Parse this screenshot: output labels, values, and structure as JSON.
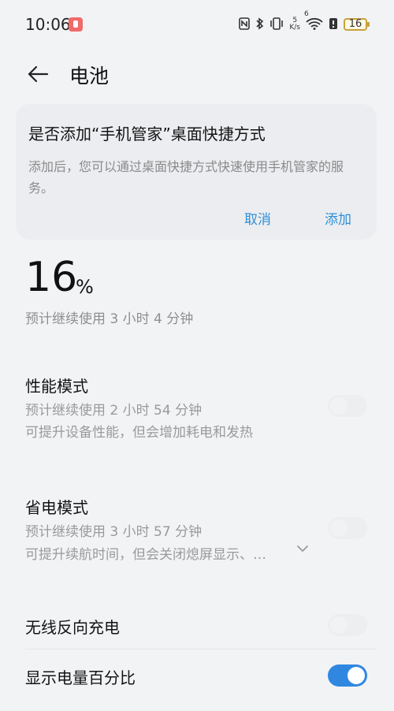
{
  "status_bar": {
    "time": "10:06",
    "net_speed_value": "5",
    "net_speed_unit": "K/s",
    "wifi_label": "6",
    "battery_level": "16"
  },
  "header": {
    "title": "电池"
  },
  "shortcut_card": {
    "title": "是否添加“手机管家”桌面快捷方式",
    "description": "添加后，您可以通过桌面快捷方式快速使用手机管家的服务。",
    "cancel_label": "取消",
    "add_label": "添加"
  },
  "battery": {
    "percent": "16",
    "unit": "%",
    "estimate": "预计继续使用 3 小时 4 分钟"
  },
  "settings": {
    "performance": {
      "title": "性能模式",
      "estimate": "预计继续使用 2 小时 54 分钟",
      "description": "可提升设备性能，但会增加耗电和发热",
      "enabled": false
    },
    "power_saving": {
      "title": "省电模式",
      "estimate": "预计继续使用 3 小时 57 分钟",
      "description": "可提升续航时间，但会关闭熄屏显示、…",
      "enabled": false
    },
    "reverse_charging": {
      "title": "无线反向充电",
      "enabled": false
    },
    "show_percentage": {
      "title": "显示电量百分比",
      "enabled": true
    }
  },
  "colors": {
    "accent": "#2f87e0",
    "link": "#2f8fd8",
    "background": "#f2f3f5",
    "card": "#ebedf0"
  }
}
